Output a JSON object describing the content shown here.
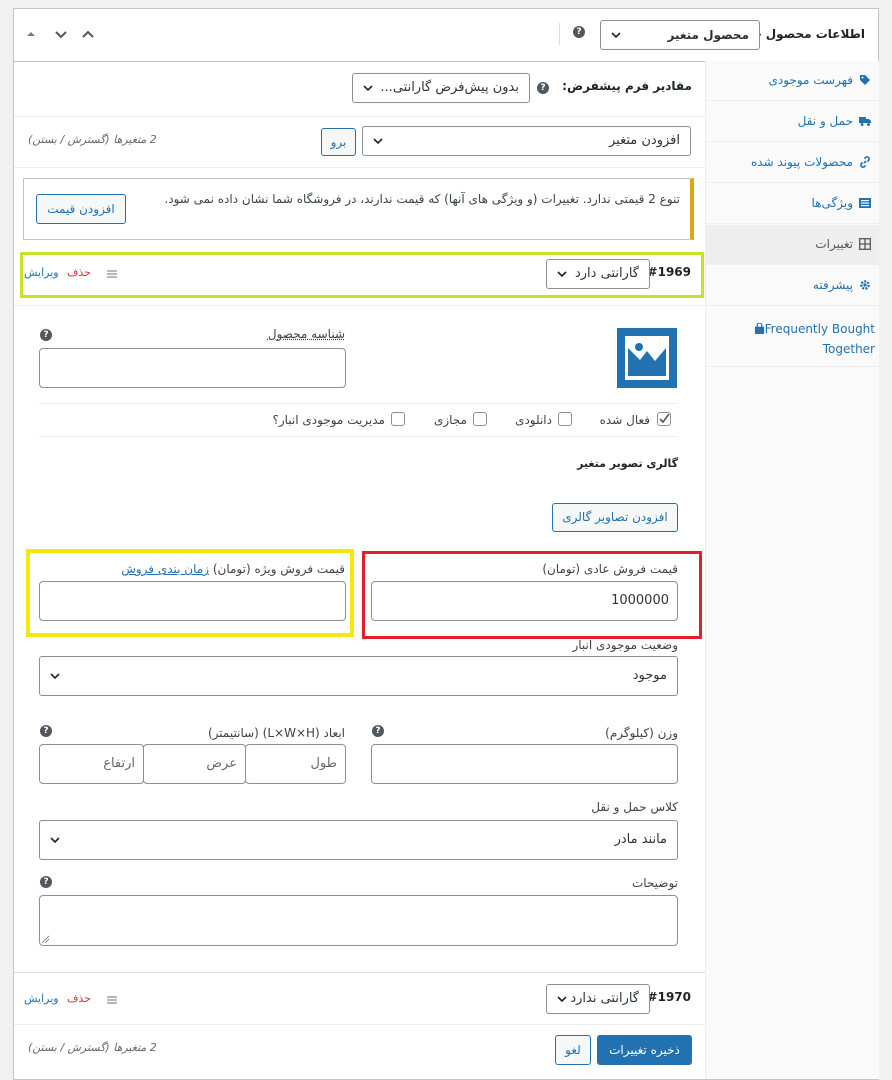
{
  "header": {
    "title": "اطلاعات محصول —",
    "product_type": "محصول متغیر",
    "help": "?"
  },
  "tabs": [
    {
      "label": "فهرست موجودی",
      "icon": "tag-icon"
    },
    {
      "label": "حمل و نقل",
      "icon": "truck-icon"
    },
    {
      "label": "محصولات پیوند شده",
      "icon": "link-icon"
    },
    {
      "label": "ویژگی‌ها",
      "icon": "list-icon"
    },
    {
      "label": "تغییرات",
      "icon": "grid-icon"
    },
    {
      "label": "پیشرفته",
      "icon": "gear-icon"
    },
    {
      "label": "Frequently Bought Together",
      "icon": "bag-icon"
    }
  ],
  "defaults": {
    "label": "مقادیر فرم پیشفرض:",
    "value": "بدون پیش‌فرض گارانتی..."
  },
  "add_variation": {
    "select": "افزودن متغیر",
    "go": "برو",
    "count_text": "2 متغیرها (گسترش / بستن)"
  },
  "notice": {
    "text": "تنوع 2 قیمتی ندارد. تغییرات (و ویژگی های آنها) که قیمت ندارند، در فروشگاه شما نشان داده نمی شود.",
    "button": "افزودن قیمت"
  },
  "variation1": {
    "id": "#1969",
    "attr": "گارانتی دارد",
    "delete": "حذف",
    "edit": "ویرایش",
    "sku_label": "شناسه محصول",
    "enabled": "فعال شده",
    "downloadable": "دانلودی",
    "virtual": "مجازی",
    "manage_stock": "مدیریت موجودی انبار؟",
    "gallery_title": "گالری تصویر متغیر",
    "gallery_button": "افزودن تصاویر گالری",
    "regular_price_label": "قیمت فروش عادی (تومان)",
    "regular_price_value": "1000000",
    "sale_price_label": "قیمت فروش ویژه (تومان)",
    "schedule_link": "زمان بندی فروش",
    "stock_status_label": "وضعیت موجودی انبار",
    "stock_status_value": "موجود",
    "weight_label": "وزن (کیلوگرم)",
    "dims_label": "ابعاد (L×W×H) (سانتیمتر)",
    "length_ph": "طول",
    "width_ph": "عرض",
    "height_ph": "ارتفاع",
    "shipping_label": "کلاس حمل و نقل",
    "shipping_value": "مانند مادر",
    "desc_label": "توضیحات"
  },
  "variation2": {
    "id": "#1970",
    "attr": "گارانتی ندارد",
    "delete": "حذف",
    "edit": "ویرایش"
  },
  "footer": {
    "save": "ذخیره تغییرات",
    "cancel": "لغو",
    "count_text": "2 متغیرها (گسترش / بستن)"
  },
  "colors": {
    "highlight_green": "#c8e02a",
    "highlight_red": "#e3202a",
    "highlight_yellow": "#f5e70c",
    "notice_border": "#dba617",
    "primary": "#2271b1",
    "danger": "#d63638"
  }
}
